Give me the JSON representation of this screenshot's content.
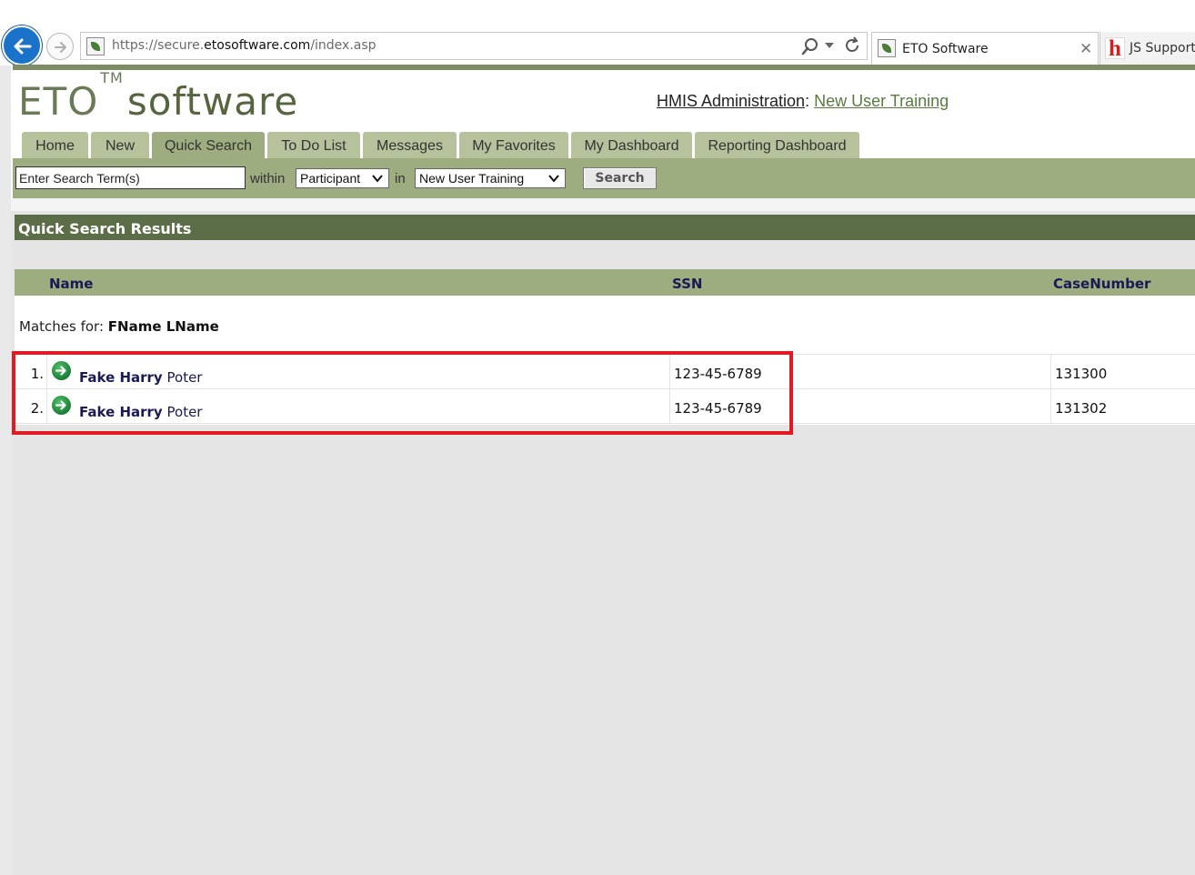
{
  "browser": {
    "url_prefix": "https://secure.",
    "url_domain": "etosoftware.com",
    "url_path": "/index.asp",
    "active_tab_title": "ETO Software",
    "inactive_tab_title": "JS Support"
  },
  "header": {
    "logo_text_a": "ETO",
    "logo_tm": "TM",
    "logo_text_b": "software",
    "admin_link": "HMIS Administration",
    "separator": ":",
    "program_link": "New User Training"
  },
  "nav": {
    "tabs": [
      {
        "label": "Home"
      },
      {
        "label": "New"
      },
      {
        "label": "Quick Search"
      },
      {
        "label": "To Do List"
      },
      {
        "label": "Messages"
      },
      {
        "label": "My Favorites"
      },
      {
        "label": "My Dashboard"
      },
      {
        "label": "Reporting Dashboard"
      }
    ],
    "active_tab": "Quick Search"
  },
  "search": {
    "input_value": "Enter Search Term(s)",
    "within_label": "within",
    "within_value": "Participant",
    "in_label": "in",
    "in_value": "New User Training",
    "button_label": "Search"
  },
  "results": {
    "title": "Quick Search Results",
    "columns": [
      "Name",
      "SSN",
      "CaseNumber"
    ],
    "matches_label": "Matches for:",
    "matches_query": "FName LName",
    "rows": [
      {
        "num": "1.",
        "first": "Fake Harry",
        "last": "Poter",
        "ssn": "123-45-6789",
        "case": "131300"
      },
      {
        "num": "2.",
        "first": "Fake Harry",
        "last": "Poter",
        "ssn": "123-45-6789",
        "case": "131302"
      }
    ]
  },
  "colors": {
    "brand_green": "#9ead80",
    "header_dark_green": "#5c6e48",
    "highlight_red": "#e01b24",
    "browser_back_blue": "#1a73c8"
  }
}
